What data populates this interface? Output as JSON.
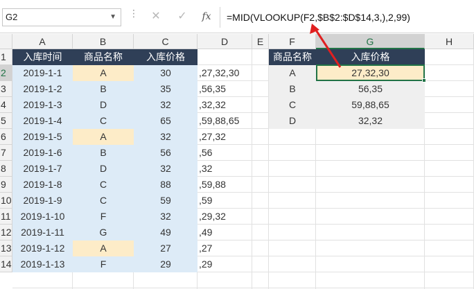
{
  "name_box": "G2",
  "formula_bar": {
    "cancel_icon": "✕",
    "enter_icon": "✓",
    "fx_label": "fx",
    "formula": "=MID(VLOOKUP(F2,$B$2:$D$14,3,),2,99)"
  },
  "columns": [
    "A",
    "B",
    "C",
    "D",
    "E",
    "F",
    "G",
    "H"
  ],
  "rows": [
    "1",
    "2",
    "3",
    "4",
    "5",
    "6",
    "7",
    "8",
    "9",
    "10",
    "11",
    "12",
    "13",
    "14"
  ],
  "left_table": {
    "headers": [
      "入库时间",
      "商品名称",
      "入库价格"
    ],
    "rows": [
      {
        "date": "2019-1-1",
        "name": "A",
        "price": "30",
        "d": ",27,32,30",
        "hl": true
      },
      {
        "date": "2019-1-2",
        "name": "B",
        "price": "35",
        "d": ",56,35",
        "hl": false
      },
      {
        "date": "2019-1-3",
        "name": "D",
        "price": "32",
        "d": ",32,32",
        "hl": false
      },
      {
        "date": "2019-1-4",
        "name": "C",
        "price": "65",
        "d": ",59,88,65",
        "hl": false
      },
      {
        "date": "2019-1-5",
        "name": "A",
        "price": "32",
        "d": ",27,32",
        "hl": true
      },
      {
        "date": "2019-1-6",
        "name": "B",
        "price": "56",
        "d": ",56",
        "hl": false
      },
      {
        "date": "2019-1-7",
        "name": "D",
        "price": "32",
        "d": ",32",
        "hl": false
      },
      {
        "date": "2019-1-8",
        "name": "C",
        "price": "88",
        "d": ",59,88",
        "hl": false
      },
      {
        "date": "2019-1-9",
        "name": "C",
        "price": "59",
        "d": ",59",
        "hl": false
      },
      {
        "date": "2019-1-10",
        "name": "F",
        "price": "32",
        "d": ",29,32",
        "hl": false
      },
      {
        "date": "2019-1-11",
        "name": "G",
        "price": "49",
        "d": ",49",
        "hl": false
      },
      {
        "date": "2019-1-12",
        "name": "A",
        "price": "27",
        "d": ",27",
        "hl": true
      },
      {
        "date": "2019-1-13",
        "name": "F",
        "price": "29",
        "d": ",29",
        "hl": false
      }
    ]
  },
  "right_table": {
    "headers": [
      "商品名称",
      "入库价格"
    ],
    "rows": [
      {
        "name": "A",
        "price": "27,32,30"
      },
      {
        "name": "B",
        "price": "56,35"
      },
      {
        "name": "C",
        "price": "59,88,65"
      },
      {
        "name": "D",
        "price": "32,32"
      }
    ]
  },
  "colors": {
    "header_bg": "#2f3f57",
    "blue_fill": "#ddebf7",
    "highlight_fill": "#fdecc8",
    "arrow": "#e02020",
    "selection": "#217346"
  }
}
